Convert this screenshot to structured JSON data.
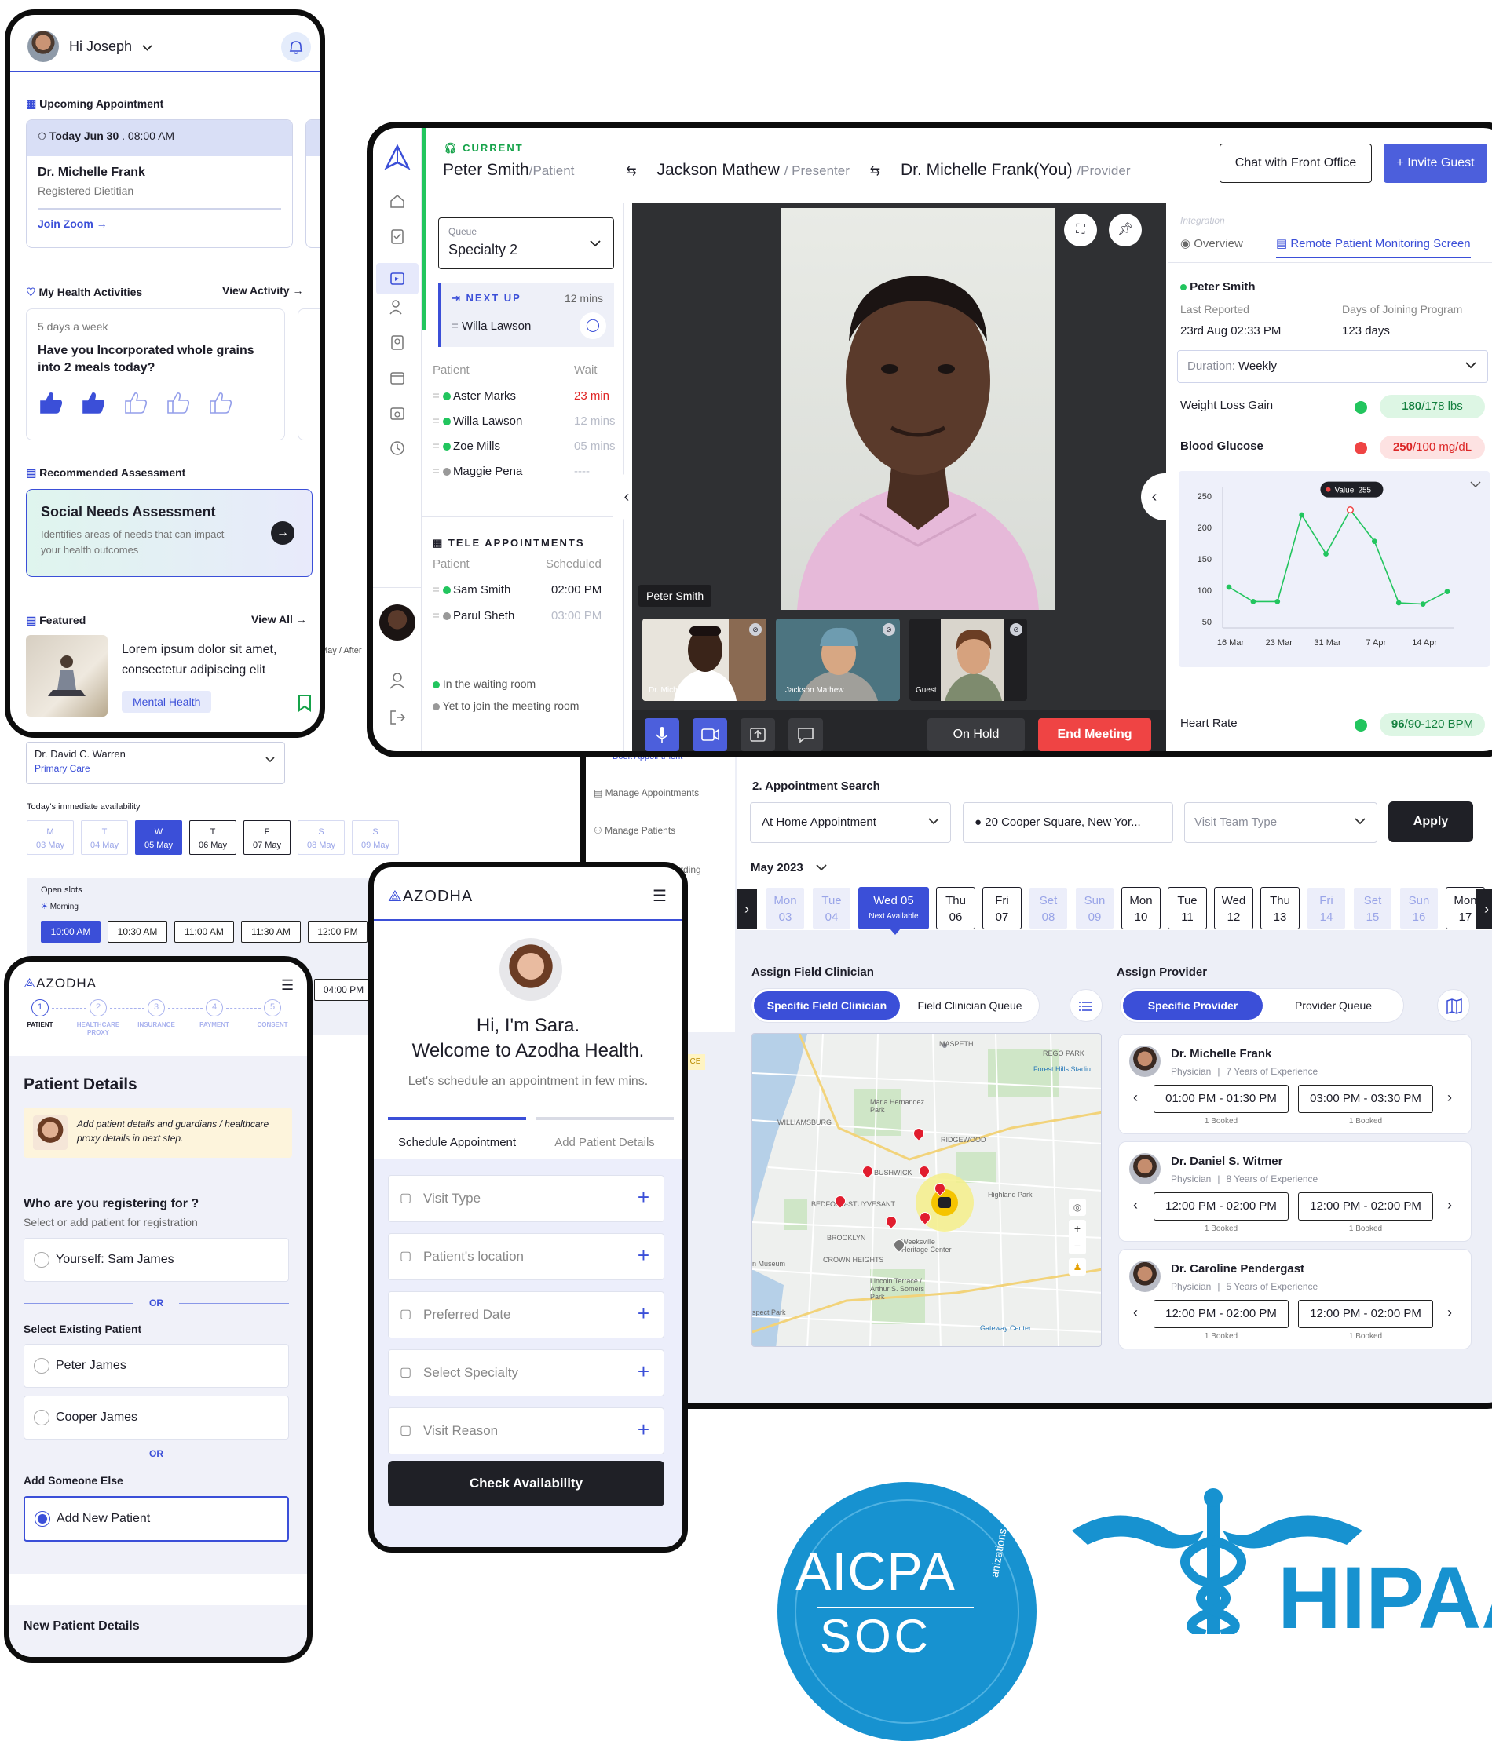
{
  "patient_app": {
    "greeting": "Hi Joseph",
    "upcoming_title": "Upcoming Appointment",
    "appt_date": "Today Jun 30",
    "appt_time": ". 08:00 AM",
    "appt_doctor": "Dr. Michelle Frank",
    "appt_role": "Registered Dietitian",
    "join_label": "Join Zoom",
    "activities_title": "My Health Activities",
    "view_activity": "View  Activity",
    "activity_freq": "5 days a week",
    "activity_question": "Have you Incorporated whole grains into 2 meals today?",
    "assessment_section": "Recommended Assessment",
    "assessment_title": "Social Needs Assessment",
    "assessment_desc": "Identifies areas of needs that can impact your health outcomes",
    "featured_title": "Featured",
    "view_all": "View  All",
    "featured_text": "Lorem ipsum dolor sit amet, consectetur adipiscing elit",
    "featured_tag": "Mental Health"
  },
  "telehealth": {
    "current_label": "CURRENT",
    "patient_name": "Peter Smith",
    "patient_role": "/Patient",
    "presenter_name": "Jackson Mathew",
    "presenter_role": "/ Presenter",
    "provider_name": "Dr. Michelle Frank(You)",
    "provider_role": "/Provider",
    "chat_button": "Chat with Front Office",
    "invite_button": "+ Invite Guest",
    "queue_label": "Queue",
    "queue_value": "Specialty 2",
    "next_up_label": "NEXT UP",
    "next_up_time": "12 mins",
    "next_up_name": "Willa Lawson",
    "col_patient": "Patient",
    "col_wait": "Wait",
    "queue_rows": [
      {
        "name": "Aster Marks",
        "wait": "23 min",
        "status": "green",
        "wait_color": "#e02424"
      },
      {
        "name": "Willa Lawson",
        "wait": "12 mins",
        "status": "green",
        "wait_color": "#b8bcc8"
      },
      {
        "name": "Zoe Mills",
        "wait": "05 mins",
        "status": "green",
        "wait_color": "#b8bcc8"
      },
      {
        "name": "Maggie Pena",
        "wait": "----",
        "status": "gray",
        "wait_color": "#b8bcc8"
      }
    ],
    "tele_title": "TELE APPOINTMENTS",
    "col_scheduled": "Scheduled",
    "tele_rows": [
      {
        "name": "Sam Smith",
        "time": "02:00 PM",
        "status": "green",
        "time_color": "#1d1d28"
      },
      {
        "name": "Parul Sheth",
        "time": "03:00 PM",
        "status": "gray",
        "time_color": "#b8bcc8"
      }
    ],
    "legend_waiting": "In the waiting room",
    "legend_yet": "Yet to join the meeting room",
    "video_main_name": "Peter Smith",
    "thumb_1": "Dr. Michelle Frank",
    "thumb_2": "Jackson Mathew",
    "thumb_3": "Guest",
    "on_hold": "On Hold",
    "end_meeting": "End Meeting",
    "integration_label": "Integration",
    "tab_overview": "Overview",
    "tab_rpm": "Remote Patient Monitoring Screen",
    "rpm_patient": "Peter Smith",
    "last_reported_label": "Last Reported",
    "last_reported_value": "23rd Aug 02:33 PM",
    "days_label": "Days of Joining Program",
    "days_value": "123 days",
    "duration_label": "Duration:",
    "duration_value": "Weekly",
    "weight_label": "Weight Loss Gain",
    "weight_value": "180",
    "weight_target": "/178 lbs",
    "glucose_label": "Blood Glucose",
    "glucose_value": "250",
    "glucose_target": "/100 mg/dL",
    "heart_label": "Heart Rate",
    "heart_value": "96",
    "heart_target": "/90-120 BPM",
    "tooltip_label": "Value",
    "tooltip_value": "255"
  },
  "chart_data": {
    "type": "line",
    "x": [
      "16 Mar",
      "",
      "23 Mar",
      "",
      "31 Mar",
      "",
      "7 Apr",
      "",
      "14 Apr",
      ""
    ],
    "values": [
      105,
      82,
      82,
      220,
      158,
      228,
      178,
      80,
      78,
      98
    ],
    "yticks": [
      250,
      200,
      150,
      100,
      50
    ],
    "xticks": [
      "16 Mar",
      "23 Mar",
      "31 Mar",
      "7 Apr",
      "14 Apr"
    ],
    "ylim": [
      40,
      265
    ],
    "color": "#22c55e"
  },
  "scheduler": {
    "provider_select": "Dr. David C. Warren",
    "provider_specialty": "Primary Care",
    "availability_title": "Today's immediate availability",
    "week_days": [
      {
        "d": "M",
        "date": "03 May",
        "state": "muted"
      },
      {
        "d": "T",
        "date": "04 May",
        "state": "muted"
      },
      {
        "d": "W",
        "date": "05 May",
        "state": "active"
      },
      {
        "d": "T",
        "date": "06 May",
        "state": "normal"
      },
      {
        "d": "F",
        "date": "07 May",
        "state": "normal"
      },
      {
        "d": "S",
        "date": "08 May",
        "state": "muted"
      },
      {
        "d": "S",
        "date": "09 May",
        "state": "muted"
      }
    ],
    "open_slots": "Open slots",
    "morning": "Morning",
    "slots": [
      "10:00 AM",
      "10:30 AM",
      "11:00 AM",
      "11:30 AM",
      "12:00 PM"
    ],
    "slot_afternoon": "04:00 PM",
    "partial_text": "May / After",
    "menu_book": "Book Appointment",
    "menu_manage_appointments": "Manage Appointments",
    "menu_manage_patients": "Manage Patients",
    "menu_partial": "rding",
    "search_title": "2. Appointment Search",
    "appt_type": "At Home Appointment",
    "location": "20 Cooper Square, New Yor...",
    "visit_team": "Visit Team Type",
    "apply": "Apply",
    "month": "May 2023",
    "dates": [
      {
        "d": "Mon",
        "n": "03",
        "state": "muted"
      },
      {
        "d": "Tue",
        "n": "04",
        "state": "muted"
      },
      {
        "d": "Wed 05",
        "n": "Next Available",
        "state": "active"
      },
      {
        "d": "Thu",
        "n": "06",
        "state": "normal"
      },
      {
        "d": "Fri",
        "n": "07",
        "state": "normal"
      },
      {
        "d": "Set",
        "n": "08",
        "state": "muted"
      },
      {
        "d": "Sun",
        "n": "09",
        "state": "muted"
      },
      {
        "d": "Mon",
        "n": "10",
        "state": "normal"
      },
      {
        "d": "Tue",
        "n": "11",
        "state": "normal"
      },
      {
        "d": "Wed",
        "n": "12",
        "state": "normal"
      },
      {
        "d": "Thu",
        "n": "13",
        "state": "normal"
      },
      {
        "d": "Fri",
        "n": "14",
        "state": "muted"
      },
      {
        "d": "Set",
        "n": "15",
        "state": "muted"
      },
      {
        "d": "Sun",
        "n": "16",
        "state": "muted"
      },
      {
        "d": "Mon",
        "n": "17",
        "state": "normal"
      }
    ],
    "assign_clinician": "Assign Field Clinician",
    "specific_clinician": "Specific Field Clinician",
    "clinician_queue": "Field Clinician Queue",
    "assign_provider": "Assign Provider",
    "specific_provider": "Specific Provider",
    "provider_queue": "Provider Queue",
    "map_labels": [
      "MASPETH",
      "Forest Hills Stadiu",
      "Maria Hernandez Park",
      "WILLIAMSBURG",
      "BUSHWICK",
      "RIDGEWOOD",
      "Highland Park",
      "BEDFORD-STUYVESANT",
      "BROOKLYN",
      "Weeksville Heritage Center",
      "CROWN HEIGHTS",
      "Lincoln Terrace / Arthur S. Somers Park",
      "Gateway Center",
      "n Museum",
      "spect Park",
      "REGO PARK"
    ],
    "providers": [
      {
        "name": "Dr. Michelle Frank",
        "title": "Physician",
        "exp": "7 Years of Experience",
        "slot1": "01:00 PM - 01:30 PM",
        "slot2": "03:00 PM - 03:30 PM",
        "booked": "1 Booked"
      },
      {
        "name": "Dr. Daniel S. Witmer",
        "title": "Physician",
        "exp": "8 Years of Experience",
        "slot1": "12:00 PM - 02:00 PM",
        "slot2": "12:00 PM - 02:00 PM",
        "booked": "1 Booked"
      },
      {
        "name": "Dr. Caroline Pendergast",
        "title": "Physician",
        "exp": "5 Years of Experience",
        "slot1": "12:00 PM - 02:00 PM",
        "slot2": "12:00 PM - 02:00 PM",
        "booked": "1 Booked"
      }
    ]
  },
  "registration": {
    "brand": "AZODHA",
    "steps": [
      "PATIENT",
      "HEALTHCARE PROXY",
      "INSURANCE",
      "PAYMENT",
      "CONSENT"
    ],
    "title": "Patient Details",
    "note": "Add patient details and guardians / healthcare proxy details in next step.",
    "question": "Who are you registering for ?",
    "question_sub": "Select or add patient for registration",
    "yourself": "Yourself: Sam James",
    "or": "OR",
    "existing": "Select Existing Patient",
    "patient_1": "Peter James",
    "patient_2": "Cooper James",
    "someone_else": "Add Someone Else",
    "add_new": "Add New Patient",
    "new_details": "New Patient Details",
    "partial_ce": "CE"
  },
  "assistant": {
    "brand": "AZODHA",
    "hello": "Hi, I'm Sara.",
    "welcome": "Welcome to Azodha Health.",
    "sub": "Let's schedule an appointment in few mins.",
    "tab_schedule": "Schedule Appointment",
    "tab_details": "Add Patient Details",
    "fields": [
      {
        "label": "Visit Type",
        "icon": "document-icon"
      },
      {
        "label": "Patient's location",
        "icon": "location-pin-icon"
      },
      {
        "label": "Preferred Date",
        "icon": "calendar-icon"
      },
      {
        "label": "Select Specialty",
        "icon": "stethoscope-icon"
      },
      {
        "label": "Visit Reason",
        "icon": "user-note-icon"
      }
    ],
    "check": "Check Availability"
  },
  "badges": {
    "aicpa": "AICPA",
    "soc": "SOC",
    "aicpa_side": "anizations",
    "hipaa": "HIPAA"
  }
}
